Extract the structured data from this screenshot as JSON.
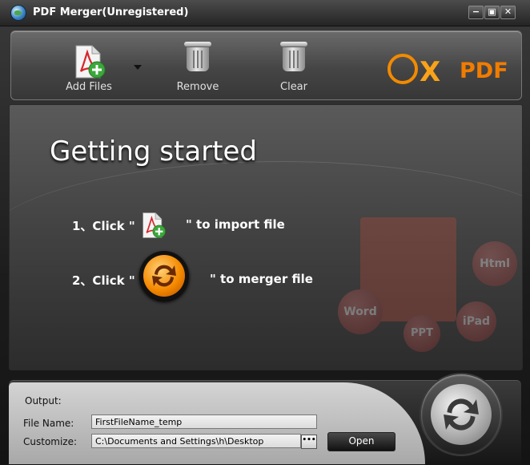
{
  "window": {
    "title": "PDF Merger(Unregistered)"
  },
  "titlebar_buttons": {
    "minimize": "−",
    "restore": "▣",
    "close": "✕"
  },
  "toolbar": {
    "add_files_label": "Add Files",
    "remove_label": "Remove",
    "clear_label": "Clear"
  },
  "brand": {
    "ox": "X",
    "pdf": "PDF"
  },
  "main": {
    "heading": "Getting started",
    "step1_prefix": "1、Click \"",
    "step1_suffix": "\" to import file",
    "step2_prefix": "2、Click \"",
    "step2_suffix": "\" to merger file",
    "watermark": {
      "html": "Html",
      "word": "Word",
      "ppt": "PPT",
      "ipad": "iPad"
    }
  },
  "output": {
    "section_label": "Output:",
    "file_name_label": "File Name:",
    "file_name_value": "FirstFileName_temp",
    "customize_label": "Customize:",
    "customize_value": "C:\\Documents and Settings\\h\\Desktop",
    "browse_label": "•••",
    "open_label": "Open"
  },
  "colors": {
    "accent": "#f28a00",
    "pdf_red": "#d8262a",
    "add_green": "#3aa83a"
  }
}
